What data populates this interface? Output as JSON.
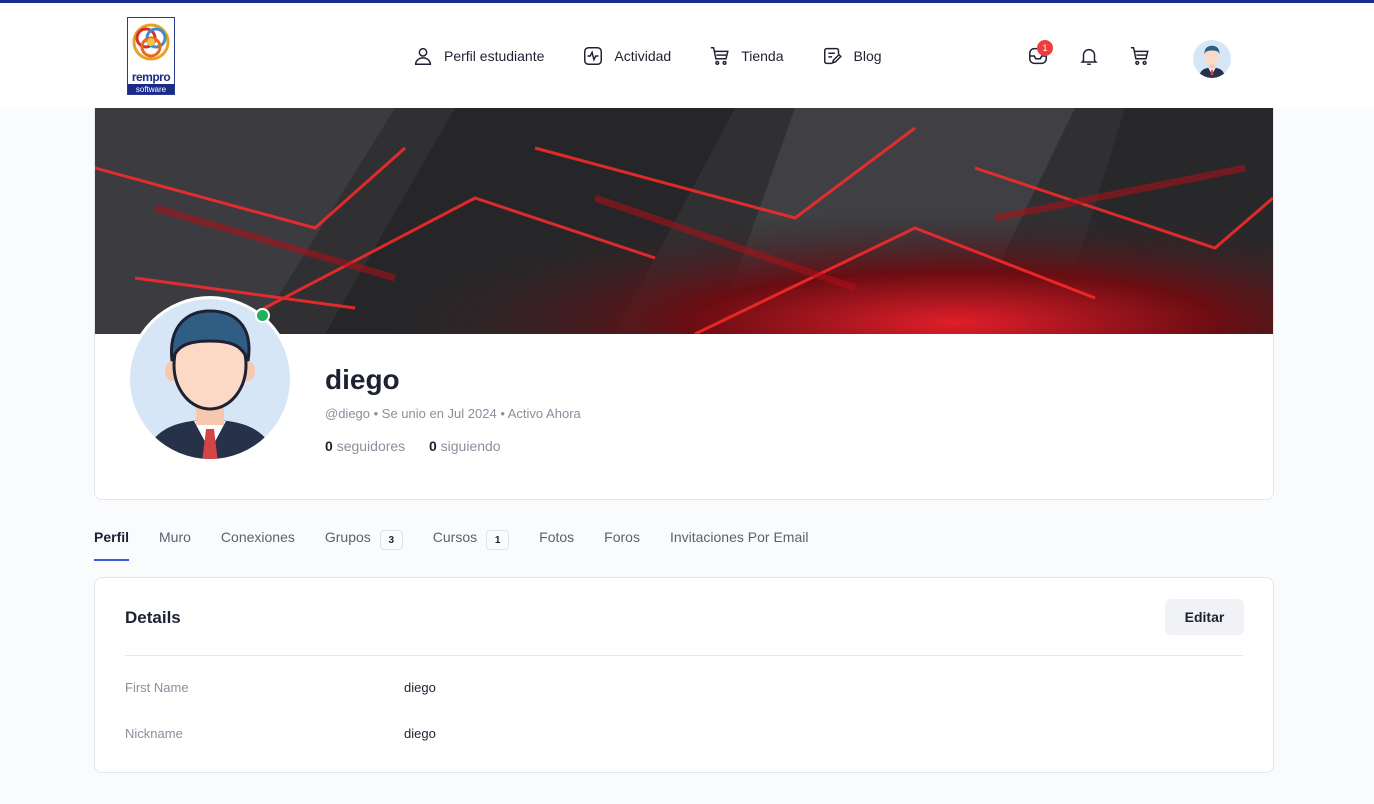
{
  "brand": {
    "word1": "rempro",
    "word2": "software"
  },
  "nav": [
    {
      "label": "Perfil estudiante",
      "icon": "user-icon"
    },
    {
      "label": "Actividad",
      "icon": "activity-icon"
    },
    {
      "label": "Tienda",
      "icon": "cart-icon"
    },
    {
      "label": "Blog",
      "icon": "blog-icon"
    }
  ],
  "header_icons": {
    "inbox_badge": "1"
  },
  "profile": {
    "name": "diego",
    "meta": "@diego • Se unio en Jul 2024 • Activo Ahora",
    "followers_count": "0",
    "followers_label": "seguidores",
    "following_count": "0",
    "following_label": "siguiendo"
  },
  "tabs": [
    {
      "label": "Perfil",
      "active": true
    },
    {
      "label": "Muro"
    },
    {
      "label": "Conexiones"
    },
    {
      "label": "Grupos",
      "count": "3"
    },
    {
      "label": "Cursos",
      "count": "1"
    },
    {
      "label": "Fotos"
    },
    {
      "label": "Foros"
    },
    {
      "label": "Invitaciones Por Email"
    }
  ],
  "details": {
    "title": "Details",
    "edit_label": "Editar",
    "rows": [
      {
        "label": "First Name",
        "value": "diego"
      },
      {
        "label": "Nickname",
        "value": "diego"
      }
    ]
  },
  "colors": {
    "accent": "#3c5ad6",
    "online": "#20b25b",
    "badge": "#ef3e3e",
    "brand": "#1c2a8a"
  }
}
